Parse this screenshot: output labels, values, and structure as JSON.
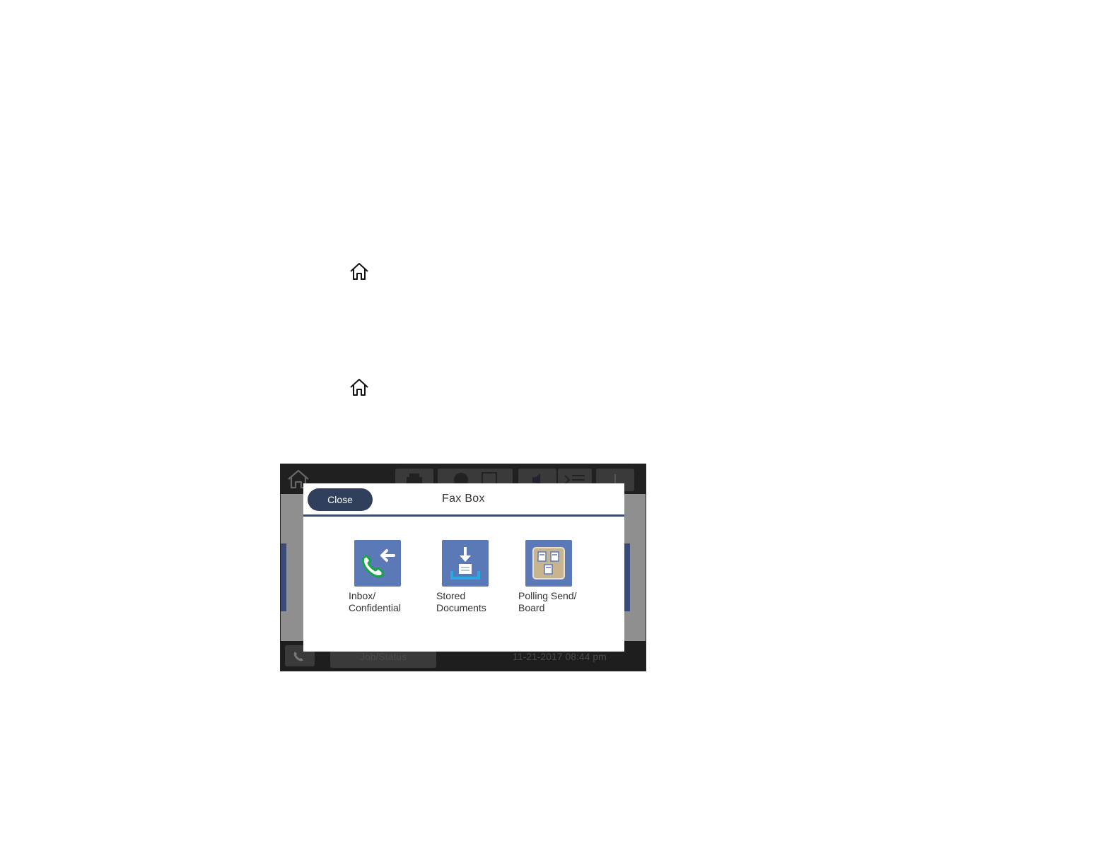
{
  "instructions": {
    "home_icon_1": "home-icon",
    "home_icon_2": "home-icon"
  },
  "screen": {
    "topbar": {
      "home_icon": "home-icon",
      "buttons": [
        "printer-icon",
        "copy-icon",
        "scan-icon",
        "sound-icon",
        "network-icon",
        "status-icon"
      ]
    },
    "background": {
      "back_icon": "back-arrow-icon"
    },
    "bottombar": {
      "phone_icon": "phone-icon",
      "job_status_label": "Job/Status",
      "datetime": "11-21-2017 08:44 pm"
    },
    "dialog": {
      "close_label": "Close",
      "title": "Fax Box",
      "items": [
        {
          "icon": "inbox-fax-icon",
          "line1": "Inbox/",
          "line2": "Confidential"
        },
        {
          "icon": "stored-documents-icon",
          "line1": "Stored",
          "line2": "Documents"
        },
        {
          "icon": "polling-board-icon",
          "line1": "Polling Send/",
          "line2": "Board"
        }
      ]
    }
  },
  "colors": {
    "dialog_header_button": "#2f3f5c",
    "icon_tile": "#5b79b7",
    "phone_green": "#1aa34a"
  }
}
